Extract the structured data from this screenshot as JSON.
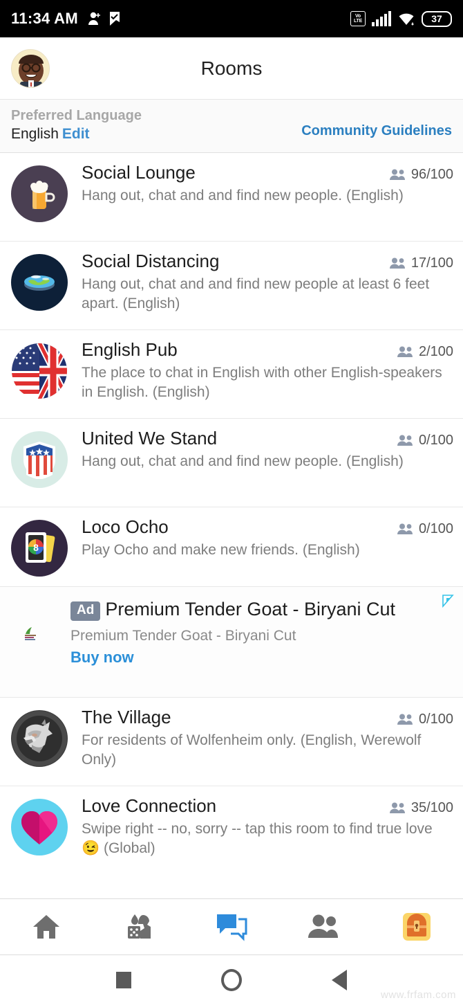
{
  "statusbar": {
    "time": "11:34 AM",
    "icons_left": [
      "add-person-icon",
      "checkmark-flag-icon"
    ],
    "volte_top": "Vo",
    "volte_bottom": "LTE",
    "icons_right": [
      "signal-icon",
      "wifi-icon"
    ],
    "battery_level": "37"
  },
  "appbar": {
    "title": "Rooms",
    "avatar": "user-avatar"
  },
  "language_bar": {
    "label": "Preferred Language",
    "value": "English",
    "edit_label": "Edit",
    "guidelines_label": "Community Guidelines",
    "link_color": "#2b7fc0"
  },
  "rooms": [
    {
      "name": "Social Lounge",
      "desc": "Hang out, chat and and find new people. (English)",
      "count": "96/100",
      "icon": "beer-mug-icon",
      "icon_bg": "#4a3f52"
    },
    {
      "name": "Social Distancing",
      "desc": "Hang out, chat and and find new people at least 6 feet apart. (English)",
      "count": "17/100",
      "icon": "flat-earth-icon",
      "icon_bg": "#0d2038"
    },
    {
      "name": "English Pub",
      "desc": "The place to chat in English with other English-speakers in English. (English)",
      "count": "2/100",
      "icon": "us-uk-flag-icon",
      "icon_bg": "#ffffff"
    },
    {
      "name": "United We Stand",
      "desc": "Hang out, chat and and find new people. (English)",
      "count": "0/100",
      "icon": "patriotic-shield-icon",
      "icon_bg": "#d8ece6"
    },
    {
      "name": "Loco Ocho",
      "desc": "Play Ocho and make new friends. (English)",
      "count": "0/100",
      "icon": "playing-cards-icon",
      "icon_bg": "#332741"
    }
  ],
  "rooms_after_ad": [
    {
      "name": "The Village",
      "desc": "For residents of Wolfenheim only. (English, Werewolf Only)",
      "count": "0/100",
      "icon": "wolf-head-icon",
      "icon_bg": "#3a3a3a"
    },
    {
      "name": "Love Connection",
      "desc": "Swipe right -- no, sorry -- tap this room to find true love 😉 (Global)",
      "count": "35/100",
      "icon": "heart-icon",
      "icon_bg": "#5ed2ef"
    }
  ],
  "ad": {
    "badge": "Ad",
    "title": "Premium Tender Goat - Biryani Cut",
    "subtitle": "Premium Tender Goat - Biryani Cut",
    "cta": "Buy now",
    "cta_color": "#2b8fd8",
    "badge_color": "#7a8699",
    "adchoices_icon": "adchoices-icon",
    "thumb": "ad-thumbnail-icon"
  },
  "bottom_nav": {
    "items": [
      {
        "icon": "home-icon",
        "label": "Home",
        "active": false
      },
      {
        "icon": "games-dice-icon",
        "label": "Games",
        "active": false
      },
      {
        "icon": "chat-bubble-icon",
        "label": "Chat",
        "active": true
      },
      {
        "icon": "people-icon",
        "label": "People",
        "active": false
      },
      {
        "icon": "treasure-chest-icon",
        "label": "Treasure",
        "active": false
      }
    ],
    "active_color": "#2e8bdb",
    "inactive_color": "#6e6e6e"
  },
  "system_nav": {
    "recents": "square-recents-icon",
    "home": "circle-home-icon",
    "back": "triangle-back-icon"
  },
  "watermark": "www.frfam.com"
}
